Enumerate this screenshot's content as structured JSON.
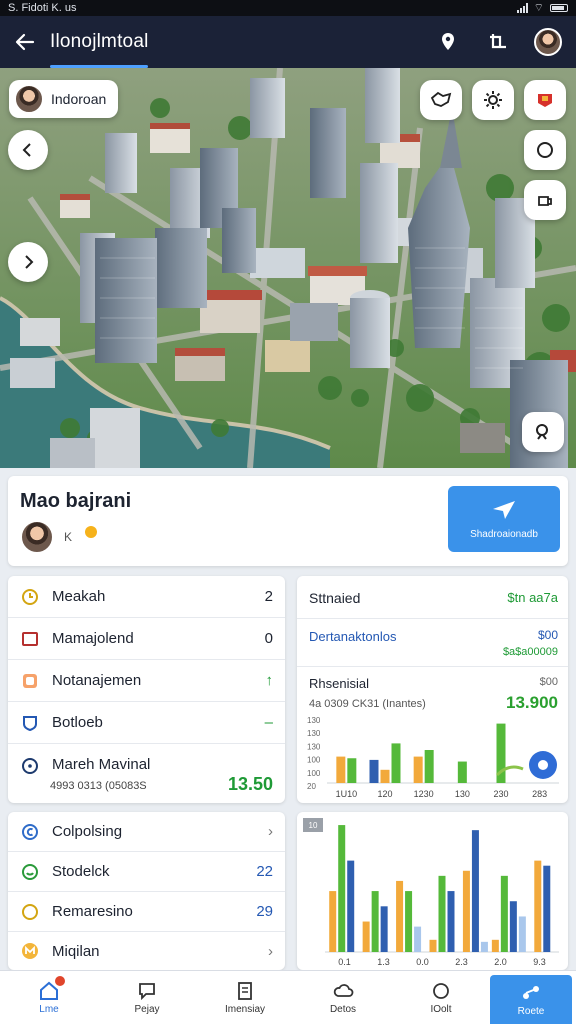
{
  "status_bar": {
    "left": "S. Fidoti K. us"
  },
  "app_bar": {
    "title": "Ilonojlmtoal",
    "icons": [
      "arrow-left-icon",
      "place-icon",
      "crop-icon",
      "avatar"
    ]
  },
  "map": {
    "location_chip": "Indoroan",
    "controls": [
      "chevron-left-icon",
      "chevron-right-icon",
      "tag-icon",
      "gear-icon",
      "bookmark-icon",
      "circle-icon",
      "share-icon",
      "zoom-icon"
    ]
  },
  "place": {
    "name": "Mao bajrani",
    "sub": "K",
    "button_label": "Shadroaionadb"
  },
  "list1": {
    "rows": [
      {
        "label": "Meakah",
        "value": "2",
        "icon": "clock-icon"
      },
      {
        "label": "Mamajolend",
        "value": "0",
        "icon": "card-icon"
      },
      {
        "label": "Notanajemen",
        "value": "↑",
        "icon": "tile-icon"
      },
      {
        "label": "Botloeb",
        "value": "–",
        "icon": "shield-icon"
      },
      {
        "label": "Mareh Mavinal",
        "sub": "4993 0313 (05083S",
        "value": "13.50",
        "icon": "pin-icon"
      }
    ]
  },
  "stats": {
    "r1_label": "Sttnaied",
    "r1_value": "$tn aa7a",
    "r2_label": "Dertanaktonlos",
    "r2_value1": "$00",
    "r2_value2": "$a$a00009",
    "r3_label": "Rhsenisial",
    "r3_value": "$00",
    "r3_sub": "4a 0309 CK31 (Inantes)",
    "r3_big": "13.900"
  },
  "list2": {
    "rows": [
      {
        "label": "Colpolsing",
        "value": "›",
        "icon": "c-circle-icon"
      },
      {
        "label": "Stodelck",
        "value": "22",
        "icon": "smile-icon"
      },
      {
        "label": "Remaresino",
        "value": "29",
        "icon": "circle-icon"
      },
      {
        "label": "Miqilan",
        "value": "›",
        "icon": "m-icon"
      }
    ]
  },
  "chart_data": [
    {
      "type": "bar",
      "categories": [
        "1U10",
        "120",
        "1230",
        "130",
        "230",
        "283"
      ],
      "series": [
        {
          "color": "#2f5fb0",
          "values": [
            null,
            28,
            null,
            null,
            null,
            null
          ]
        },
        {
          "color": "#f2a93b",
          "values": [
            32,
            16,
            32,
            null,
            null,
            null
          ]
        },
        {
          "color": "#55b93a",
          "values": [
            30,
            48,
            40,
            26,
            72,
            null
          ]
        }
      ],
      "ylabels": [
        "130",
        "130",
        "130",
        "100",
        "100",
        "20"
      ],
      "ylim": [
        0,
        80
      ]
    },
    {
      "type": "bar",
      "title": "10",
      "categories": [
        "0.1",
        "1.3",
        "0.0",
        "2.3",
        "2.0",
        "9.3"
      ],
      "series": [
        {
          "color": "#f2a93b",
          "values": [
            60,
            30,
            70,
            12,
            80,
            12,
            90
          ]
        },
        {
          "color": "#55b93a",
          "values": [
            125,
            60,
            60,
            75,
            null,
            75,
            null
          ]
        },
        {
          "color": "#2f5fb0",
          "values": [
            90,
            45,
            null,
            60,
            120,
            50,
            85
          ]
        },
        {
          "color": "#a9c7ec",
          "values": [
            null,
            null,
            25,
            null,
            10,
            35,
            null
          ]
        }
      ],
      "ylim": [
        0,
        130
      ]
    }
  ],
  "nav": {
    "items": [
      {
        "label": "Lme",
        "icon": "home-icon"
      },
      {
        "label": "Pejay",
        "icon": "chat-icon"
      },
      {
        "label": "Imensiay",
        "icon": "document-icon"
      },
      {
        "label": "Detos",
        "icon": "cloud-icon"
      },
      {
        "label": "IOolt",
        "icon": "circle-icon"
      },
      {
        "label": "Roete",
        "icon": "route-icon"
      }
    ]
  }
}
